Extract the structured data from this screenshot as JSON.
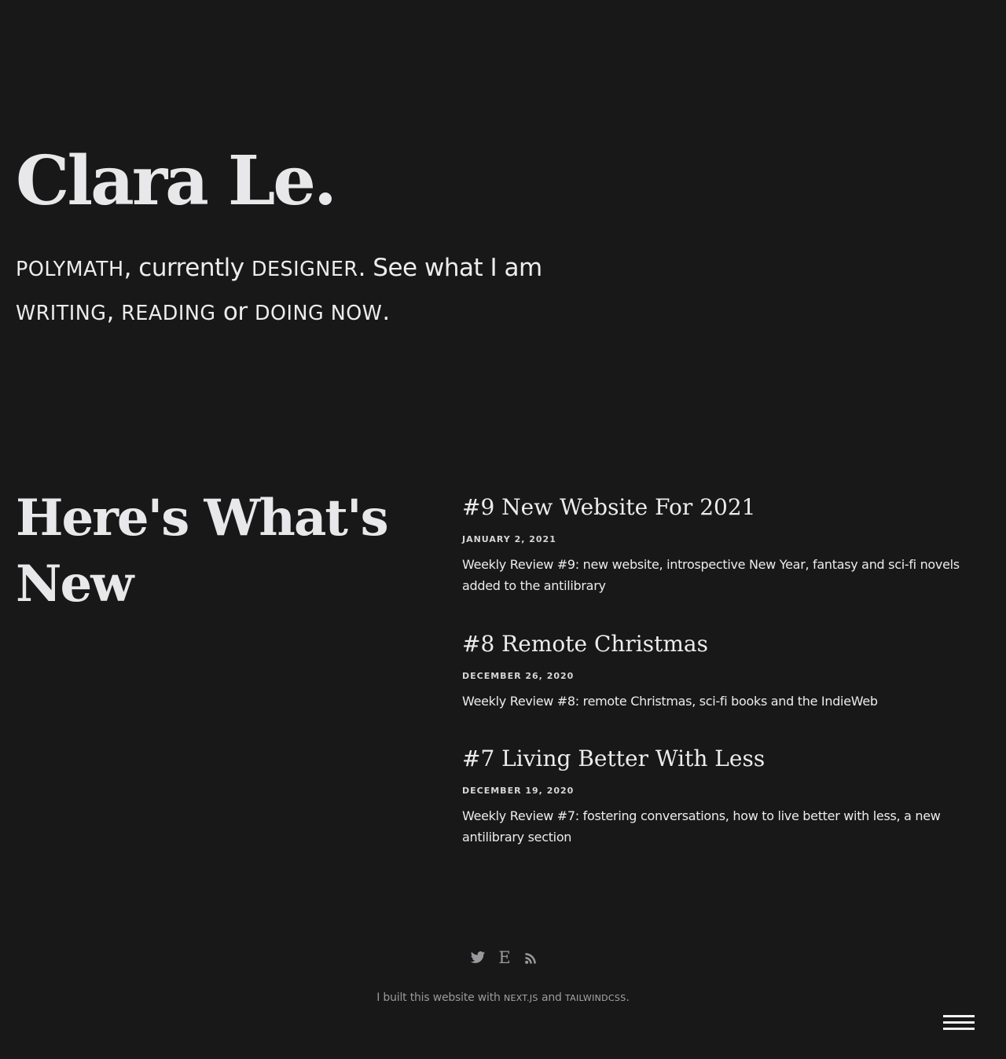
{
  "hero": {
    "name": "Clara Le.",
    "tagline": {
      "role": "POLYMATH",
      "sep1": ", currently ",
      "current": "DESIGNER",
      "sep2": ". See what I am ",
      "writing": "WRITING",
      "sep3": ", ",
      "reading": "READING",
      "sep4": " or ",
      "doing": "DOING NOW",
      "end": "."
    }
  },
  "section": {
    "title": "Here's What's New"
  },
  "posts": [
    {
      "title": "#9 New Website For 2021",
      "date": "JANUARY 2, 2021",
      "description": "Weekly Review #9: new website, introspective New Year, fantasy and sci-fi novels added to the antilibrary"
    },
    {
      "title": "#8 Remote Christmas",
      "date": "DECEMBER 26, 2020",
      "description": "Weekly Review #8: remote Christmas, sci-fi books and the IndieWeb"
    },
    {
      "title": "#7 Living Better With Less",
      "date": "DECEMBER 19, 2020",
      "description": "Weekly Review #7: fostering conversations, how to live better with less, a new antilibrary section"
    }
  ],
  "footer": {
    "icons": [
      "twitter-icon",
      "e-icon",
      "rss-icon"
    ],
    "e_glyph": "E",
    "note_prefix": "I built this website with ",
    "tech1": "NEXT.JS",
    "note_mid": " and ",
    "tech2": "TAILWINDCSS",
    "note_suffix": "."
  },
  "colors": {
    "background": "#181818",
    "text": "#e8e8ea",
    "muted": "#9a9a9e"
  }
}
